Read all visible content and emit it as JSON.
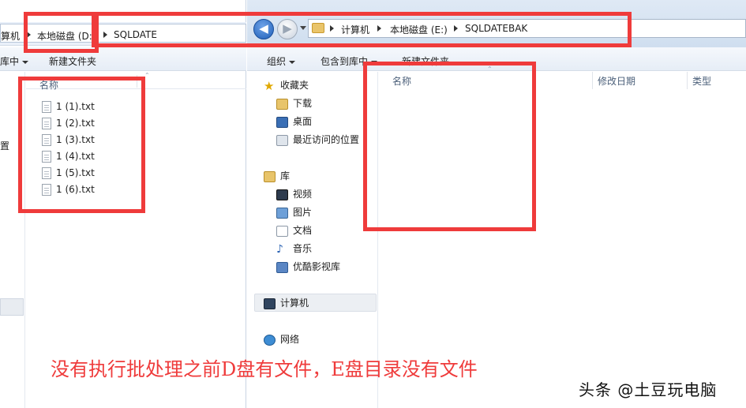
{
  "left_window": {
    "address": {
      "crumb_computer": "算机",
      "crumb_drive": "本地磁盘 (D:",
      "crumb_folder": "SQLDATE"
    },
    "toolbar": {
      "include_library": "库中",
      "new_folder": "新建文件夹"
    },
    "nav_partial_text": "置",
    "column_name": "名称",
    "files": [
      "1 (1).txt",
      "1 (2).txt",
      "1 (3).txt",
      "1 (4).txt",
      "1 (5).txt",
      "1 (6).txt"
    ]
  },
  "right_window": {
    "address": {
      "crumb_computer": "计算机",
      "crumb_drive": "本地磁盘 (E:)",
      "crumb_folder": "SQLDATEBAK"
    },
    "toolbar": {
      "organize": "组织",
      "include_library": "包含到库中",
      "new_folder": "新建文件夹"
    },
    "nav": {
      "favorites": "收藏夹",
      "downloads": "下载",
      "desktop": "桌面",
      "recent": "最近访问的位置",
      "libraries": "库",
      "videos": "视频",
      "pictures": "图片",
      "documents": "文档",
      "music": "音乐",
      "youku": "优酷影视库",
      "computer": "计算机",
      "network": "网络"
    },
    "columns": {
      "name": "名称",
      "modified": "修改日期",
      "type": "类型"
    }
  },
  "annotation": {
    "caption": "没有执行批处理之前D盘有文件，E盘目录没有文件",
    "watermark": "头条 @土豆玩电脑",
    "color": "#ef3b3b"
  }
}
